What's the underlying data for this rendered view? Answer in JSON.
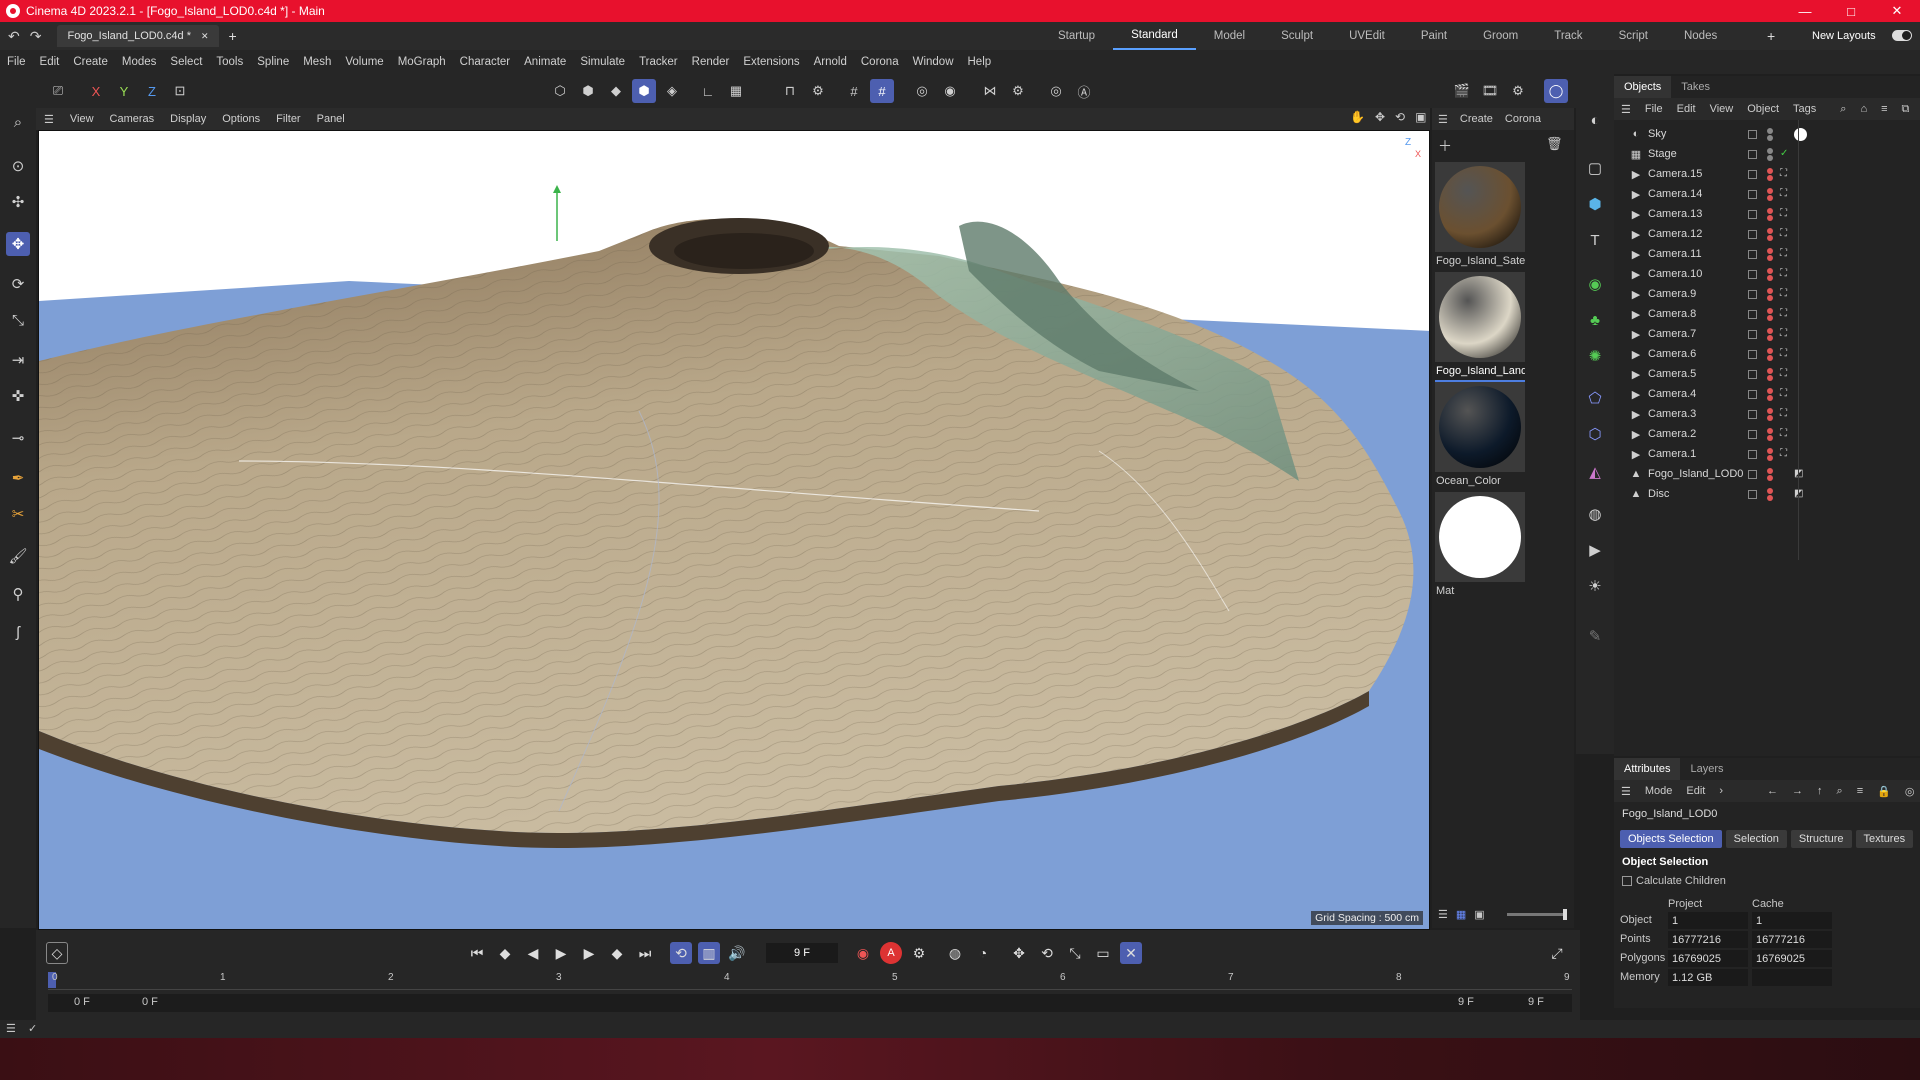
{
  "titlebar": {
    "title": "Cinema 4D 2023.2.1 - [Fogo_Island_LOD0.c4d *] - Main",
    "min": "—",
    "max": "□",
    "close": "✕"
  },
  "tabs": {
    "doc_tab": "Fogo_Island_LOD0.c4d *",
    "doc_close": "✕",
    "add": "+",
    "layouts": [
      "Startup",
      "Standard",
      "Model",
      "Sculpt",
      "UVEdit",
      "Paint",
      "Groom",
      "Track",
      "Script",
      "Nodes"
    ],
    "active_layout": "Standard",
    "new_layouts": "New Layouts"
  },
  "menu": [
    "File",
    "Edit",
    "Create",
    "Modes",
    "Select",
    "Tools",
    "Spline",
    "Mesh",
    "Volume",
    "MoGraph",
    "Character",
    "Animate",
    "Simulate",
    "Tracker",
    "Render",
    "Extensions",
    "Arnold",
    "Corona",
    "Window",
    "Help"
  ],
  "toolbar": {
    "x": "X",
    "y": "Y",
    "z": "Z"
  },
  "viewport_menu": [
    "View",
    "Cameras",
    "Display",
    "Options",
    "Filter",
    "Panel"
  ],
  "viewport": {
    "grid_spacing": "Grid Spacing : 500 cm",
    "axis_z": "Z",
    "axis_x": "X"
  },
  "materials": {
    "menu": [
      "Create",
      "Corona"
    ],
    "items": [
      {
        "name": "Fogo_Island_Satel",
        "color": "#6b5030"
      },
      {
        "name": "Fogo_Island_Land",
        "color": "#dcd6c6"
      },
      {
        "name": "Ocean_Color",
        "color": "#0d1a2a"
      },
      {
        "name": "Mat",
        "color": "#ffffff"
      }
    ]
  },
  "objects": {
    "tabs": [
      "Objects",
      "Takes"
    ],
    "menu": [
      "File",
      "Edit",
      "View",
      "Object",
      "Tags"
    ],
    "items": [
      {
        "name": "Sky",
        "icon": "sky-icon"
      },
      {
        "name": "Stage",
        "icon": "stage-icon"
      },
      {
        "name": "Camera.15",
        "icon": "camera-icon"
      },
      {
        "name": "Camera.14",
        "icon": "camera-icon"
      },
      {
        "name": "Camera.13",
        "icon": "camera-icon"
      },
      {
        "name": "Camera.12",
        "icon": "camera-icon"
      },
      {
        "name": "Camera.11",
        "icon": "camera-icon"
      },
      {
        "name": "Camera.10",
        "icon": "camera-icon"
      },
      {
        "name": "Camera.9",
        "icon": "camera-icon"
      },
      {
        "name": "Camera.8",
        "icon": "camera-icon"
      },
      {
        "name": "Camera.7",
        "icon": "camera-icon"
      },
      {
        "name": "Camera.6",
        "icon": "camera-icon"
      },
      {
        "name": "Camera.5",
        "icon": "camera-icon"
      },
      {
        "name": "Camera.4",
        "icon": "camera-icon"
      },
      {
        "name": "Camera.3",
        "icon": "camera-icon"
      },
      {
        "name": "Camera.2",
        "icon": "camera-icon"
      },
      {
        "name": "Camera.1",
        "icon": "camera-icon"
      },
      {
        "name": "Fogo_Island_LOD0",
        "icon": "polygon-object-icon"
      },
      {
        "name": "Disc",
        "icon": "polygon-object-icon"
      }
    ]
  },
  "attributes": {
    "tabs": [
      "Attributes",
      "Layers"
    ],
    "menu": [
      "Mode",
      "Edit"
    ],
    "object_name": "Fogo_Island_LOD0",
    "subtabs": [
      "Objects Selection",
      "Selection",
      "Structure",
      "Textures"
    ],
    "active_subtab": "Objects Selection",
    "section": "Object Selection",
    "calc_children": "Calculate Children",
    "col_project": "Project",
    "col_cache": "Cache",
    "rows": [
      {
        "label": "Object",
        "project": "1",
        "cache": "1"
      },
      {
        "label": "Points",
        "project": "16777216",
        "cache": "16777216"
      },
      {
        "label": "Polygons",
        "project": "16769025",
        "cache": "16769025"
      },
      {
        "label": "Memory",
        "project": "1.12 GB",
        "cache": ""
      }
    ]
  },
  "timeline": {
    "current_frame": "9 F",
    "ticks": [
      "0",
      "1",
      "2",
      "3",
      "4",
      "5",
      "6",
      "7",
      "8",
      "9"
    ],
    "start": "0 F",
    "range_start": "0 F",
    "range_end": "9 F",
    "end": "9 F"
  },
  "colors": {
    "accent": "#4d5fb0",
    "titlebar": "#e8112d"
  }
}
